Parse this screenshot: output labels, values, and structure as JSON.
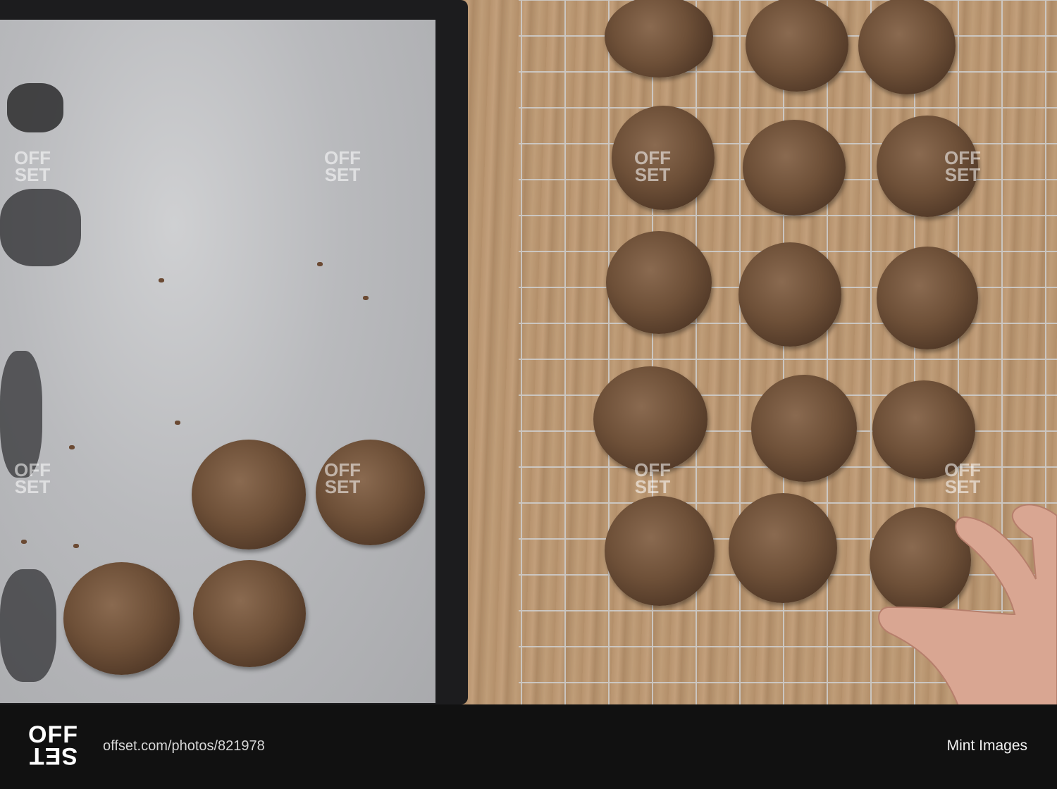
{
  "footer": {
    "logo_top": "OFF",
    "logo_bottom": "SET",
    "url": "offset.com/photos/821978",
    "credit": "Mint Images"
  }
}
